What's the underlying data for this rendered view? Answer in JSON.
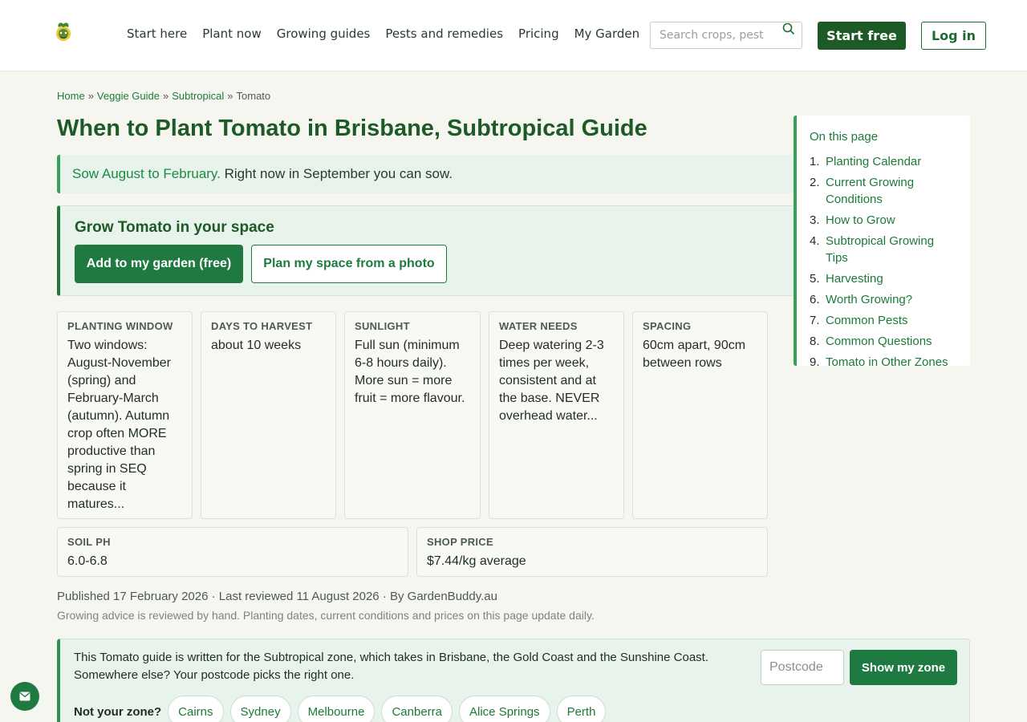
{
  "header": {
    "logo_icon": "sprout-logo-icon",
    "nav": [
      "Start here",
      "Plant now",
      "Growing guides",
      "Pests and remedies",
      "Pricing",
      "My Garden"
    ],
    "search_placeholder": "Search crops, pest",
    "start_label": "Start free",
    "login_label": "Log in"
  },
  "breadcrumb": [
    "Home",
    "Veggie Guide",
    "Subtropical",
    "Tomato"
  ],
  "page_title": "When to Plant Tomato in Brisbane, Subtropical Guide",
  "sow": {
    "highlight": "Sow August to February.",
    "rest": " Right now in September you can sow."
  },
  "grow_box": {
    "title": "Grow Tomato in your space",
    "add_label": "Add to my garden (free)",
    "plan_label": "Plan my space from a photo"
  },
  "facts": [
    {
      "label": "Planting window",
      "value": "Two windows: August-November (spring) and February-March (autumn). Autumn crop often MORE productive than spring in SEQ because it matures..."
    },
    {
      "label": "Days to harvest",
      "value": "about 10 weeks"
    },
    {
      "label": "Sunlight",
      "value": "Full sun (minimum 6-8 hours daily). More sun = more fruit = more flavour."
    },
    {
      "label": "Water needs",
      "value": "Deep watering 2-3 times per week, consistent and at the base. NEVER overhead water..."
    },
    {
      "label": "Spacing",
      "value": "60cm apart, 90cm between rows"
    },
    {
      "label": "Soil pH",
      "value": "6.0-6.8"
    },
    {
      "label": "Shop price",
      "value": "$7.44/kg average"
    }
  ],
  "published": "Published 17 February 2026 · Last reviewed 11 August 2026 · By GardenBuddy.au",
  "reviewed_note": "Growing advice is reviewed by hand. Planting dates, current conditions and prices on this page update daily.",
  "zone": {
    "text": "This Tomato guide is written for the Subtropical zone, which takes in Brisbane, the Gold Coast and the Sunshine Coast. Somewhere else? Your postcode picks the right one.",
    "postcode_placeholder": "Postcode",
    "show_label": "Show my zone",
    "not_your_zone": "Not your zone?",
    "chips": [
      "Cairns",
      "Sydney",
      "Melbourne",
      "Canberra",
      "Alice Springs",
      "Perth"
    ]
  },
  "toc": {
    "title": "On this page",
    "items": [
      {
        "num": "1.",
        "label": "Planting Calendar"
      },
      {
        "num": "2.",
        "label": "Current Growing Conditions"
      },
      {
        "num": "3.",
        "label": "How to Grow"
      },
      {
        "num": "4.",
        "label": "Subtropical Growing Tips"
      },
      {
        "num": "5.",
        "label": "Harvesting"
      },
      {
        "num": "6.",
        "label": "Worth Growing?"
      },
      {
        "num": "7.",
        "label": "Common Pests"
      },
      {
        "num": "8.",
        "label": "Common Questions"
      },
      {
        "num": "9.",
        "label": "Tomato in Other Zones"
      }
    ]
  },
  "chat_icon": "mail-icon",
  "colors": {
    "brand_dark": "#1c5a26",
    "brand": "#1f7a42",
    "link": "#1d7a3a",
    "tint": "#e7f3eb"
  }
}
